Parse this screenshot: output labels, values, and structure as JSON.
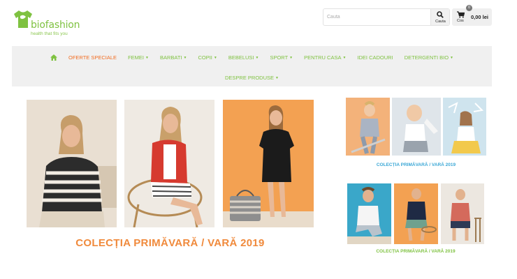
{
  "brand": {
    "name": "biofashion",
    "tagline": "health that fits you"
  },
  "search": {
    "placeholder": "Cauta",
    "button_label": "Cauta"
  },
  "cart": {
    "label": "Cos",
    "count": "0",
    "total": "0,00 lei"
  },
  "nav": {
    "row1": [
      {
        "label": "OFERTE SPECIALE",
        "dropdown": false
      },
      {
        "label": "FEMEI",
        "dropdown": true
      },
      {
        "label": "BARBATI",
        "dropdown": true
      },
      {
        "label": "COPII",
        "dropdown": true
      },
      {
        "label": "BEBELUSI",
        "dropdown": true
      },
      {
        "label": "SPORT",
        "dropdown": true
      },
      {
        "label": "PENTRU CASA",
        "dropdown": true
      },
      {
        "label": "IDEI CADOURI",
        "dropdown": false
      },
      {
        "label": "DETERGENTI BIO",
        "dropdown": true
      }
    ],
    "row2": [
      {
        "label": "DESPRE PRODUSE",
        "dropdown": true
      }
    ],
    "caret": "▼"
  },
  "banners": {
    "main_caption": "COLECȚIA PRIMĂVARĂ / VARĂ 2019",
    "kids_caption": "COLECȚIA PRIMĂVARĂ / VARĂ 2019",
    "men_caption": "COLECȚIA PRIMĂVARĂ / VARĂ 2019"
  },
  "colors": {
    "brand_green": "#7fc241",
    "special_orange": "#f26d22",
    "caption_orange": "#f08a3c",
    "caption_blue": "#3aa7d6"
  }
}
